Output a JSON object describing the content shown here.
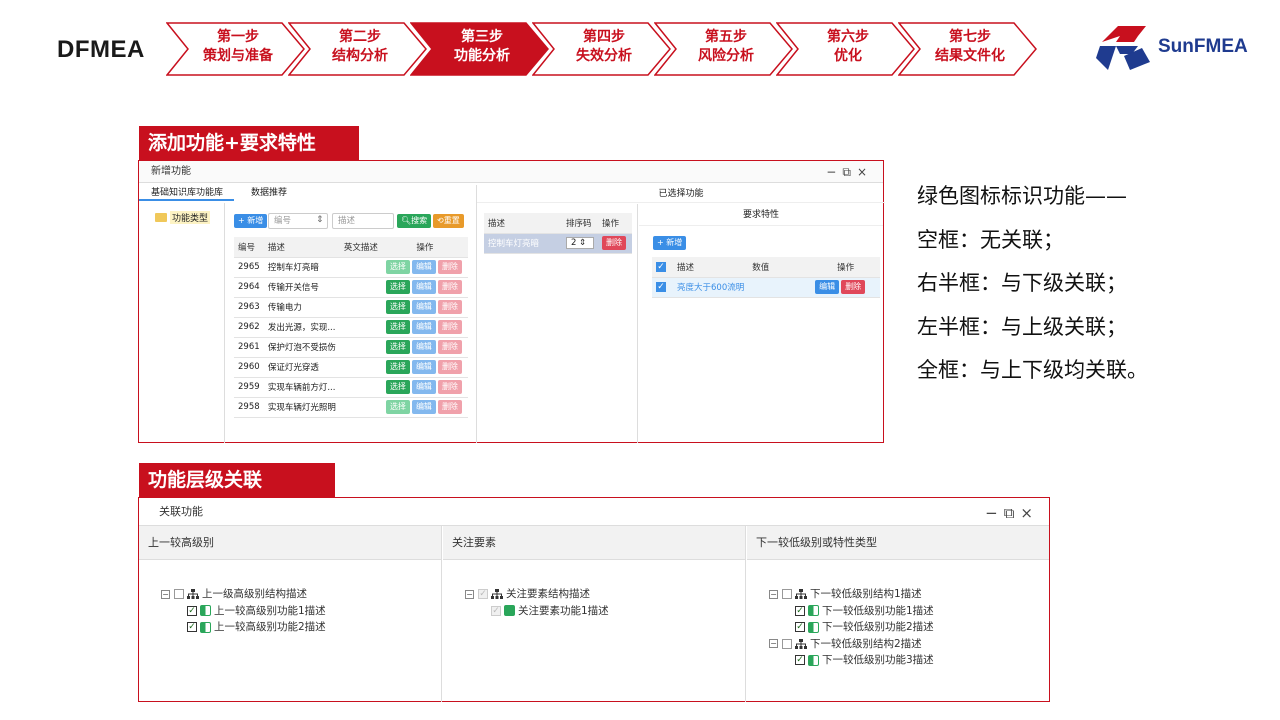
{
  "header": {
    "brand": "DFMEA",
    "logo_text": "SunFMEA",
    "steps": [
      {
        "step": "第一步",
        "label": "策划与准备"
      },
      {
        "step": "第二步",
        "label": "结构分析"
      },
      {
        "step": "第三步",
        "label": "功能分析",
        "active": true
      },
      {
        "step": "第四步",
        "label": "失效分析"
      },
      {
        "step": "第五步",
        "label": "风险分析"
      },
      {
        "step": "第六步",
        "label": "优化"
      },
      {
        "step": "第七步",
        "label": "结果文件化"
      }
    ]
  },
  "section1": {
    "title": "添加功能+要求特性",
    "dialog_title": "新增功能",
    "tabs": [
      "基础知识库功能库",
      "数据推荐"
    ],
    "tree_item": "功能类型",
    "toolbar": {
      "add": "+ 新增",
      "code_placeholder": "编号",
      "desc_placeholder": "描述",
      "search": "搜索",
      "reset": "重置"
    },
    "table_headers": [
      "编号",
      "描述",
      "英文描述",
      "操作"
    ],
    "row_buttons": {
      "select": "选择",
      "edit": "编辑",
      "delete": "删除"
    },
    "rows": [
      {
        "id": "2965",
        "desc": "控制车灯亮暗"
      },
      {
        "id": "2964",
        "desc": "传输开关信号"
      },
      {
        "id": "2963",
        "desc": "传输电力"
      },
      {
        "id": "2962",
        "desc": "发出光源，实现..."
      },
      {
        "id": "2961",
        "desc": "保护灯泡不受损伤"
      },
      {
        "id": "2960",
        "desc": "保证灯光穿透"
      },
      {
        "id": "2959",
        "desc": "实现车辆前方灯..."
      },
      {
        "id": "2958",
        "desc": "实现车辆灯光照明"
      }
    ],
    "selected": {
      "title": "已选择功能",
      "headers": [
        "描述",
        "排序码",
        "操作"
      ],
      "row": {
        "desc": "控制车灯亮暗",
        "order": "2",
        "delete": "删除"
      }
    },
    "requirements": {
      "title": "要求特性",
      "add": "+ 新增",
      "headers": [
        "描述",
        "数值",
        "操作"
      ],
      "row": {
        "desc": "亮度大于600流明",
        "value": "",
        "edit": "编辑",
        "delete": "删除"
      }
    }
  },
  "notes": [
    "绿色图标标识功能——",
    "空框：无关联；",
    "右半框：与下级关联；",
    "左半框：与上级关联；",
    "全框：与上下级均关联。"
  ],
  "section2": {
    "title": "功能层级关联",
    "dialog_title": "关联功能",
    "columns": [
      {
        "header": "上一较高级别",
        "root": "上一级高级别结构描述",
        "children": [
          "上一较高级别功能1描述",
          "上一较高级别功能2描述"
        ]
      },
      {
        "header": "关注要素",
        "root": "关注要素结构描述",
        "children": [
          "关注要素功能1描述"
        ]
      },
      {
        "header": "下一较低级别或特性类型",
        "groups": [
          {
            "root": "下一较低级别结构1描述",
            "children": [
              "下一较低级别功能1描述",
              "下一较低级别功能2描述"
            ]
          },
          {
            "root": "下一较低级别结构2描述",
            "children": [
              "下一较低级别功能3描述"
            ]
          }
        ]
      }
    ]
  },
  "colors": {
    "accent": "#c8101e",
    "green": "#2aa65a",
    "blue": "#3a8ee6",
    "red": "#e0485a"
  }
}
